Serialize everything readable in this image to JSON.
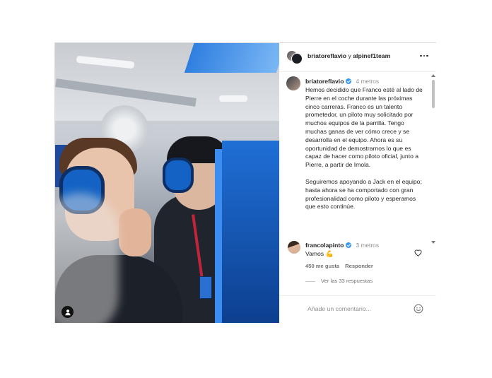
{
  "header": {
    "user1": "briatoreflavio",
    "connector": " y ",
    "user2": "alpinef1team",
    "more_icon": "more-horizontal-icon"
  },
  "caption": {
    "username": "briatoreflavio",
    "time": "4 metros",
    "paragraph1": "Hemos decidido que Franco esté al lado de Pierre en el coche durante las próximas cinco carreras. Franco es un talento prometedor, un piloto muy solicitado por muchos equipos de la parrilla. Tengo muchas ganas de ver cómo crece y se desarrolla en el equipo. Ahora es su oportunidad de demostrarnos lo que es capaz de hacer como piloto oficial, junto a Pierre, a partir de Imola.",
    "paragraph2": "Seguiremos apoyando a Jack en el equipo; hasta ahora se ha comportado con gran profesionalidad como piloto y esperamos que esto continúe."
  },
  "comment": {
    "username": "francolapinto",
    "time": "3 metros",
    "text": "Vamos",
    "emoji": "💪",
    "likes": "450 me gusta",
    "reply_label": "Responder",
    "view_replies": "Ver las 33 respuestas"
  },
  "composer": {
    "placeholder": "Añade un comentario..."
  },
  "colors": {
    "verified": "#3897f0",
    "text": "#262626",
    "muted": "#8e8e8e",
    "border": "#dbdbdb"
  }
}
